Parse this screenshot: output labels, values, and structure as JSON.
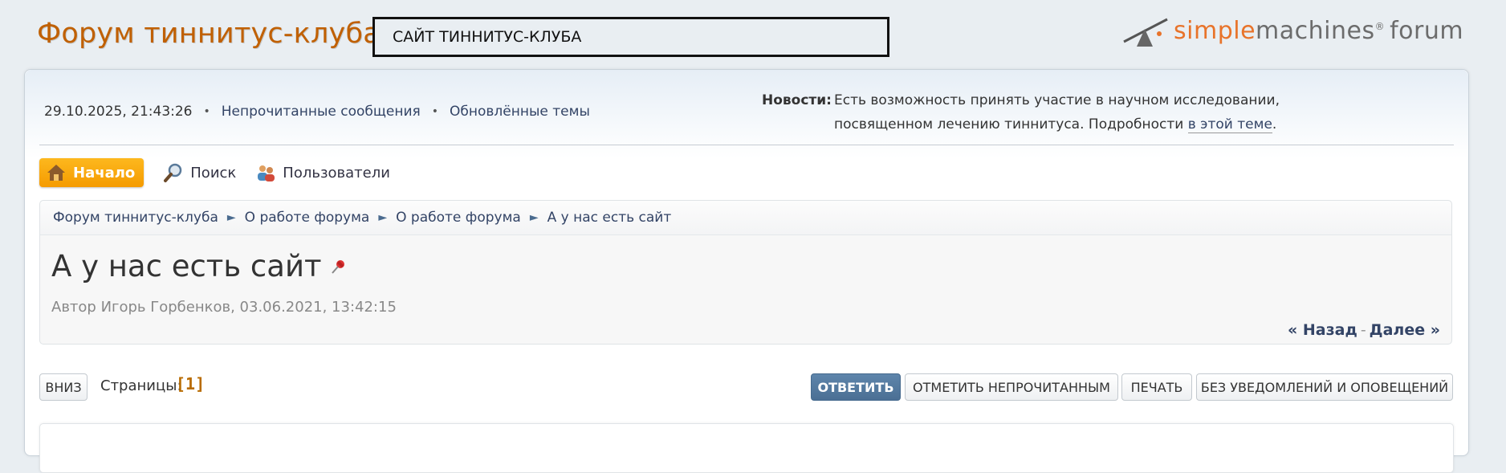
{
  "header": {
    "forum_title": "Форум тиннитус-клуба",
    "site_label": "САЙТ ТИННИТУС-КЛУБА",
    "logo": {
      "simple": "simple",
      "machines": "machines",
      "reg": "®",
      "forum": "forum"
    }
  },
  "user_bar": {
    "datetime": "29.10.2025, 21:43:26",
    "unread": "Непрочитанные сообщения",
    "updated": "Обновлённые темы"
  },
  "news": {
    "label": "Новости:",
    "text": "Есть возможность принять участие в научном исследовании, посвященном лечению тиннитуса. Подробности ",
    "link": "в этой теме",
    "end": "."
  },
  "menu": {
    "home": "Начало",
    "search": "Поиск",
    "members": "Пользователи"
  },
  "breadcrumb": [
    "Форум тиннитус-клуба",
    "О работе форума",
    "О работе форума",
    "А у нас есть сайт"
  ],
  "topic": {
    "title": "А у нас есть сайт",
    "author": "Автор Игорь Горбенков, 03.06.2021, 13:42:15",
    "prev": "« Назад",
    "sep": "-",
    "next": "Далее »"
  },
  "pagination": {
    "down": "ВНИЗ",
    "label": "Страницы:",
    "current": "[1]"
  },
  "buttons": {
    "reply": "ОТВЕТИТЬ",
    "mark_unread": "ОТМЕТИТЬ НЕПРОЧИТАННЫМ",
    "print": "ПЕЧАТЬ",
    "notify": "БЕЗ УВЕДОМЛЕНИЙ И ОПОВЕЩЕНИЙ"
  },
  "colors": {
    "forum_title": "#c06002",
    "menu_active": "#f59b00",
    "reply_button": "#4b6f94",
    "page_current": "#b86b00"
  }
}
